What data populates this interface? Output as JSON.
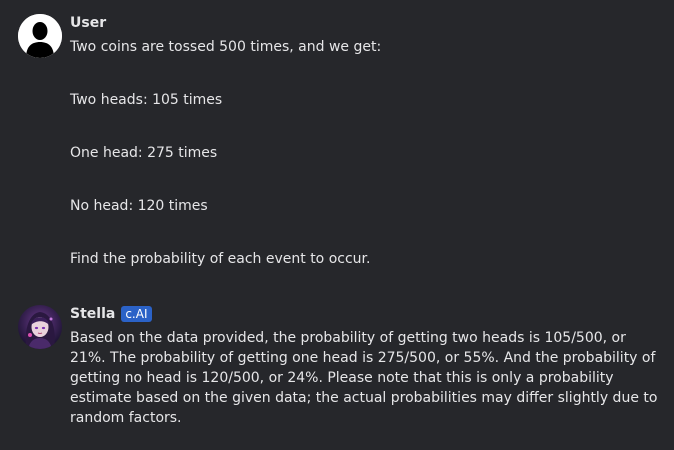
{
  "user_message": {
    "author": "User",
    "paragraphs": [
      "Two coins are tossed 500 times, and we get:",
      "Two heads: 105 times",
      "One head: 275 times",
      "No head: 120 times",
      "Find the probability of each event to occur."
    ]
  },
  "bot_message": {
    "author": "Stella",
    "badge": "c.AI",
    "text": "Based on the data provided, the probability of getting two heads is 105/500, or 21%. The probability of getting one head is 275/500, or 55%. And the probability of getting no head is 120/500, or 24%. Please note that this is only a probability estimate based on the given data; the actual probabilities may differ slightly due to random factors."
  },
  "colors": {
    "background": "#26272b",
    "text": "#e6e6e8",
    "badge": "#2b62c7"
  }
}
